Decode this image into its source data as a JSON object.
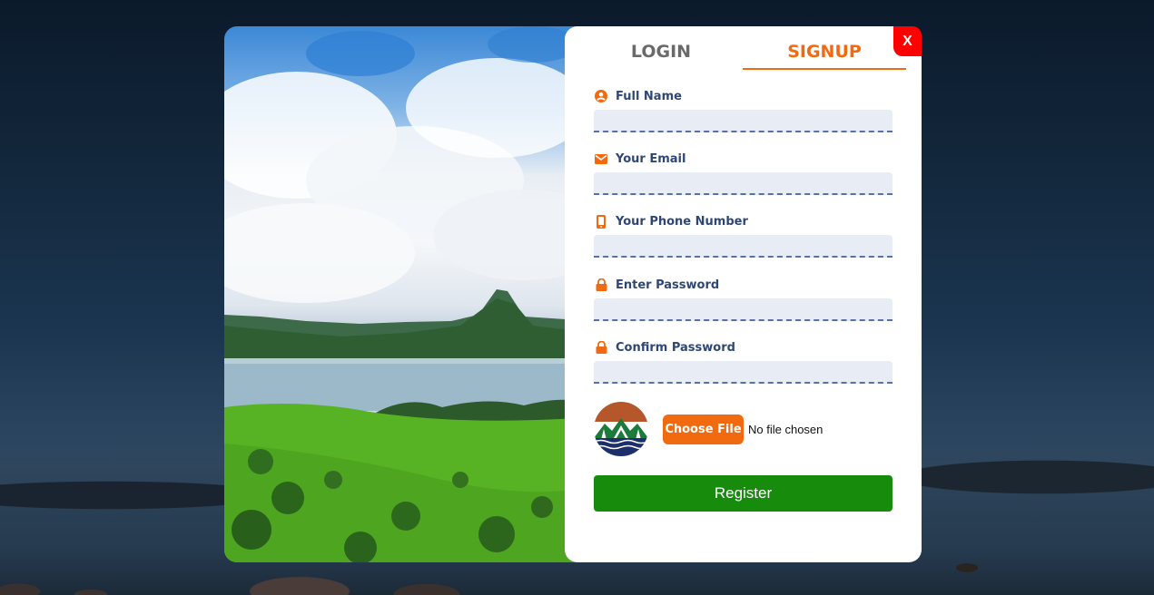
{
  "close_label": "X",
  "tabs": [
    {
      "label": "LOGIN",
      "active": false
    },
    {
      "label": "SIGNUP",
      "active": true
    }
  ],
  "fields": [
    {
      "label": "Full Name",
      "icon": "user-circle-icon",
      "value": ""
    },
    {
      "label": "Your Email",
      "icon": "envelope-icon",
      "value": ""
    },
    {
      "label": "Your Phone Number",
      "icon": "phone-icon",
      "value": ""
    },
    {
      "label": "Enter Password",
      "icon": "lock-icon",
      "value": ""
    },
    {
      "label": "Confirm Password",
      "icon": "lock-icon",
      "value": ""
    }
  ],
  "file": {
    "button_label": "Choose File",
    "status": "No file chosen"
  },
  "register_label": "Register",
  "colors": {
    "accent": "#f26a10",
    "label_text": "#2f4775",
    "register": "#178c0c",
    "close": "#ff0000"
  }
}
